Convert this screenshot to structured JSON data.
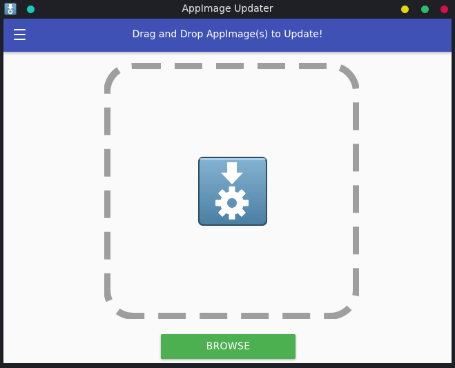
{
  "window": {
    "title": "AppImage Updater",
    "colors": {
      "pin": "#17c9c0",
      "minimize": "#e5d50b",
      "maximize": "#2ebd6a",
      "close": "#d70f4f"
    }
  },
  "app_bar": {
    "menu_icon": "hamburger-menu-icon",
    "title": "Drag and Drop AppImage(s) to Update!",
    "color": "#3f51b5"
  },
  "drop_zone": {
    "border_style": "dashed",
    "border_color": "#9e9e9e",
    "icon": "appimage-update-gear-icon"
  },
  "browse_button": {
    "label": "BROWSE",
    "color": "#4caf50"
  }
}
